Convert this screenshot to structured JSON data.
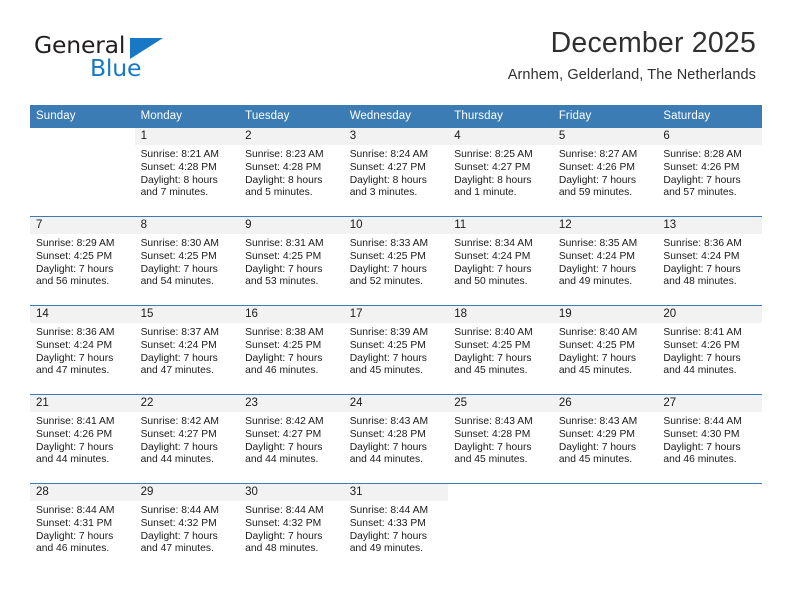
{
  "logo": {
    "primary_text": "General",
    "secondary_text": "Blue",
    "accent_color": "#1878c6",
    "triangle_icon": "triangle-icon"
  },
  "header": {
    "title": "December 2025",
    "subtitle": "Arnhem, Gelderland, The Netherlands"
  },
  "theme": {
    "header_bg": "#3b7cb5",
    "daynum_bg": "#f2f2f2",
    "text": "#1a1a1a"
  },
  "weekday_headers": [
    "Sunday",
    "Monday",
    "Tuesday",
    "Wednesday",
    "Thursday",
    "Friday",
    "Saturday"
  ],
  "weeks": [
    [
      {
        "day": "",
        "sunrise": "",
        "sunset": "",
        "daylight1": "",
        "daylight2": ""
      },
      {
        "day": "1",
        "sunrise": "Sunrise: 8:21 AM",
        "sunset": "Sunset: 4:28 PM",
        "daylight1": "Daylight: 8 hours",
        "daylight2": "and 7 minutes."
      },
      {
        "day": "2",
        "sunrise": "Sunrise: 8:23 AM",
        "sunset": "Sunset: 4:28 PM",
        "daylight1": "Daylight: 8 hours",
        "daylight2": "and 5 minutes."
      },
      {
        "day": "3",
        "sunrise": "Sunrise: 8:24 AM",
        "sunset": "Sunset: 4:27 PM",
        "daylight1": "Daylight: 8 hours",
        "daylight2": "and 3 minutes."
      },
      {
        "day": "4",
        "sunrise": "Sunrise: 8:25 AM",
        "sunset": "Sunset: 4:27 PM",
        "daylight1": "Daylight: 8 hours",
        "daylight2": "and 1 minute."
      },
      {
        "day": "5",
        "sunrise": "Sunrise: 8:27 AM",
        "sunset": "Sunset: 4:26 PM",
        "daylight1": "Daylight: 7 hours",
        "daylight2": "and 59 minutes."
      },
      {
        "day": "6",
        "sunrise": "Sunrise: 8:28 AM",
        "sunset": "Sunset: 4:26 PM",
        "daylight1": "Daylight: 7 hours",
        "daylight2": "and 57 minutes."
      }
    ],
    [
      {
        "day": "7",
        "sunrise": "Sunrise: 8:29 AM",
        "sunset": "Sunset: 4:25 PM",
        "daylight1": "Daylight: 7 hours",
        "daylight2": "and 56 minutes."
      },
      {
        "day": "8",
        "sunrise": "Sunrise: 8:30 AM",
        "sunset": "Sunset: 4:25 PM",
        "daylight1": "Daylight: 7 hours",
        "daylight2": "and 54 minutes."
      },
      {
        "day": "9",
        "sunrise": "Sunrise: 8:31 AM",
        "sunset": "Sunset: 4:25 PM",
        "daylight1": "Daylight: 7 hours",
        "daylight2": "and 53 minutes."
      },
      {
        "day": "10",
        "sunrise": "Sunrise: 8:33 AM",
        "sunset": "Sunset: 4:25 PM",
        "daylight1": "Daylight: 7 hours",
        "daylight2": "and 52 minutes."
      },
      {
        "day": "11",
        "sunrise": "Sunrise: 8:34 AM",
        "sunset": "Sunset: 4:24 PM",
        "daylight1": "Daylight: 7 hours",
        "daylight2": "and 50 minutes."
      },
      {
        "day": "12",
        "sunrise": "Sunrise: 8:35 AM",
        "sunset": "Sunset: 4:24 PM",
        "daylight1": "Daylight: 7 hours",
        "daylight2": "and 49 minutes."
      },
      {
        "day": "13",
        "sunrise": "Sunrise: 8:36 AM",
        "sunset": "Sunset: 4:24 PM",
        "daylight1": "Daylight: 7 hours",
        "daylight2": "and 48 minutes."
      }
    ],
    [
      {
        "day": "14",
        "sunrise": "Sunrise: 8:36 AM",
        "sunset": "Sunset: 4:24 PM",
        "daylight1": "Daylight: 7 hours",
        "daylight2": "and 47 minutes."
      },
      {
        "day": "15",
        "sunrise": "Sunrise: 8:37 AM",
        "sunset": "Sunset: 4:24 PM",
        "daylight1": "Daylight: 7 hours",
        "daylight2": "and 47 minutes."
      },
      {
        "day": "16",
        "sunrise": "Sunrise: 8:38 AM",
        "sunset": "Sunset: 4:25 PM",
        "daylight1": "Daylight: 7 hours",
        "daylight2": "and 46 minutes."
      },
      {
        "day": "17",
        "sunrise": "Sunrise: 8:39 AM",
        "sunset": "Sunset: 4:25 PM",
        "daylight1": "Daylight: 7 hours",
        "daylight2": "and 45 minutes."
      },
      {
        "day": "18",
        "sunrise": "Sunrise: 8:40 AM",
        "sunset": "Sunset: 4:25 PM",
        "daylight1": "Daylight: 7 hours",
        "daylight2": "and 45 minutes."
      },
      {
        "day": "19",
        "sunrise": "Sunrise: 8:40 AM",
        "sunset": "Sunset: 4:25 PM",
        "daylight1": "Daylight: 7 hours",
        "daylight2": "and 45 minutes."
      },
      {
        "day": "20",
        "sunrise": "Sunrise: 8:41 AM",
        "sunset": "Sunset: 4:26 PM",
        "daylight1": "Daylight: 7 hours",
        "daylight2": "and 44 minutes."
      }
    ],
    [
      {
        "day": "21",
        "sunrise": "Sunrise: 8:41 AM",
        "sunset": "Sunset: 4:26 PM",
        "daylight1": "Daylight: 7 hours",
        "daylight2": "and 44 minutes."
      },
      {
        "day": "22",
        "sunrise": "Sunrise: 8:42 AM",
        "sunset": "Sunset: 4:27 PM",
        "daylight1": "Daylight: 7 hours",
        "daylight2": "and 44 minutes."
      },
      {
        "day": "23",
        "sunrise": "Sunrise: 8:42 AM",
        "sunset": "Sunset: 4:27 PM",
        "daylight1": "Daylight: 7 hours",
        "daylight2": "and 44 minutes."
      },
      {
        "day": "24",
        "sunrise": "Sunrise: 8:43 AM",
        "sunset": "Sunset: 4:28 PM",
        "daylight1": "Daylight: 7 hours",
        "daylight2": "and 44 minutes."
      },
      {
        "day": "25",
        "sunrise": "Sunrise: 8:43 AM",
        "sunset": "Sunset: 4:28 PM",
        "daylight1": "Daylight: 7 hours",
        "daylight2": "and 45 minutes."
      },
      {
        "day": "26",
        "sunrise": "Sunrise: 8:43 AM",
        "sunset": "Sunset: 4:29 PM",
        "daylight1": "Daylight: 7 hours",
        "daylight2": "and 45 minutes."
      },
      {
        "day": "27",
        "sunrise": "Sunrise: 8:44 AM",
        "sunset": "Sunset: 4:30 PM",
        "daylight1": "Daylight: 7 hours",
        "daylight2": "and 46 minutes."
      }
    ],
    [
      {
        "day": "28",
        "sunrise": "Sunrise: 8:44 AM",
        "sunset": "Sunset: 4:31 PM",
        "daylight1": "Daylight: 7 hours",
        "daylight2": "and 46 minutes."
      },
      {
        "day": "29",
        "sunrise": "Sunrise: 8:44 AM",
        "sunset": "Sunset: 4:32 PM",
        "daylight1": "Daylight: 7 hours",
        "daylight2": "and 47 minutes."
      },
      {
        "day": "30",
        "sunrise": "Sunrise: 8:44 AM",
        "sunset": "Sunset: 4:32 PM",
        "daylight1": "Daylight: 7 hours",
        "daylight2": "and 48 minutes."
      },
      {
        "day": "31",
        "sunrise": "Sunrise: 8:44 AM",
        "sunset": "Sunset: 4:33 PM",
        "daylight1": "Daylight: 7 hours",
        "daylight2": "and 49 minutes."
      },
      {
        "day": "",
        "sunrise": "",
        "sunset": "",
        "daylight1": "",
        "daylight2": ""
      },
      {
        "day": "",
        "sunrise": "",
        "sunset": "",
        "daylight1": "",
        "daylight2": ""
      },
      {
        "day": "",
        "sunrise": "",
        "sunset": "",
        "daylight1": "",
        "daylight2": ""
      }
    ]
  ]
}
